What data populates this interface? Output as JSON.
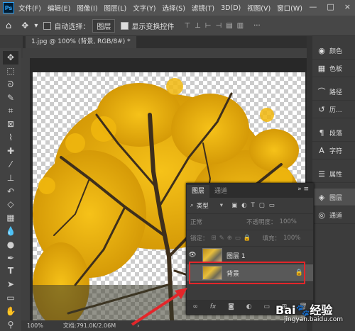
{
  "menubar": {
    "logo": "Ps",
    "items": [
      "文件(F)",
      "编辑(E)",
      "图像(I)",
      "图层(L)",
      "文字(Y)",
      "选择(S)",
      "滤镜(T)",
      "3D(D)",
      "视图(V)",
      "窗口(W)"
    ],
    "window_controls": [
      "—",
      "□",
      "×"
    ]
  },
  "options": {
    "auto_select_label": "自动选择：",
    "auto_select_value": "图层",
    "transform_label": "显示变换控件",
    "more": "···"
  },
  "document": {
    "tab_title": "1.jpg @ 100% (背景, RGB/8#) *",
    "zoom": "100%",
    "doc_info": "文档:791.0K/2.06M"
  },
  "tools": [
    "move",
    "marquee",
    "lasso",
    "quick-select",
    "crop",
    "frame",
    "eyedropper",
    "healing",
    "brush",
    "stamp",
    "history-brush",
    "eraser",
    "gradient",
    "blur",
    "dodge",
    "pen",
    "type",
    "path-select",
    "shape",
    "hand",
    "zoom"
  ],
  "side_panels": [
    {
      "label": "颜色",
      "icon": "color-icon"
    },
    {
      "label": "色板",
      "icon": "swatches-icon"
    },
    {
      "label": "路径",
      "icon": "paths-icon"
    },
    {
      "label": "历...",
      "icon": "history-icon"
    },
    {
      "label": "段落",
      "icon": "paragraph-icon"
    },
    {
      "label": "字符",
      "icon": "character-icon"
    },
    {
      "label": "属性",
      "icon": "properties-icon"
    },
    {
      "label": "图层",
      "icon": "layers-icon"
    },
    {
      "label": "通道",
      "icon": "channels-icon"
    }
  ],
  "layers_panel": {
    "tabs": [
      "图层",
      "通道"
    ],
    "kind_filter": "类型",
    "blend_mode": "正常",
    "opacity_label": "不透明度：",
    "opacity_value": "100%",
    "lock_label": "锁定：",
    "fill_label": "填充：",
    "fill_value": "100%",
    "layers": [
      {
        "name": "图层 1",
        "visible": true,
        "selected": false,
        "locked": false
      },
      {
        "name": "背景",
        "visible": false,
        "selected": true,
        "locked": true
      }
    ]
  },
  "watermark": {
    "brand": "Bai🐾经验",
    "url": "jingyan.baidu.com"
  },
  "colors": {
    "accent_red": "#e3262a",
    "panel_bg": "#3c3c3c",
    "menubar_bg": "#535353"
  }
}
